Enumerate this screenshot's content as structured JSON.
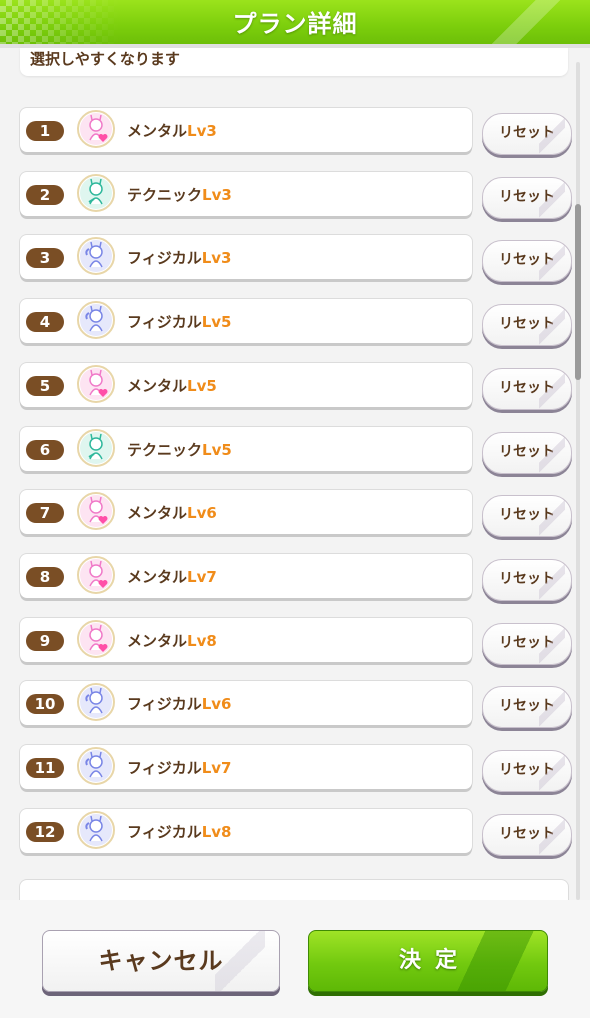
{
  "header": {
    "title": "プラン詳細"
  },
  "hint": {
    "text": "選択しやすくなります"
  },
  "rows": [
    {
      "num": "1",
      "name": "メンタル",
      "level": "Lv3",
      "icon": "mental-icon",
      "reset": "リセット"
    },
    {
      "num": "2",
      "name": "テクニック",
      "level": "Lv3",
      "icon": "technique-icon",
      "reset": "リセット"
    },
    {
      "num": "3",
      "name": "フィジカル",
      "level": "Lv3",
      "icon": "physical-icon",
      "reset": "リセット"
    },
    {
      "num": "4",
      "name": "フィジカル",
      "level": "Lv5",
      "icon": "physical-icon",
      "reset": "リセット"
    },
    {
      "num": "5",
      "name": "メンタル",
      "level": "Lv5",
      "icon": "mental-icon",
      "reset": "リセット"
    },
    {
      "num": "6",
      "name": "テクニック",
      "level": "Lv5",
      "icon": "technique-icon",
      "reset": "リセット"
    },
    {
      "num": "7",
      "name": "メンタル",
      "level": "Lv6",
      "icon": "mental-icon",
      "reset": "リセット"
    },
    {
      "num": "8",
      "name": "メンタル",
      "level": "Lv7",
      "icon": "mental-icon",
      "reset": "リセット"
    },
    {
      "num": "9",
      "name": "メンタル",
      "level": "Lv8",
      "icon": "mental-icon",
      "reset": "リセット"
    },
    {
      "num": "10",
      "name": "フィジカル",
      "level": "Lv6",
      "icon": "physical-icon",
      "reset": "リセット"
    },
    {
      "num": "11",
      "name": "フィジカル",
      "level": "Lv7",
      "icon": "physical-icon",
      "reset": "リセット"
    },
    {
      "num": "12",
      "name": "フィジカル",
      "level": "Lv8",
      "icon": "physical-icon",
      "reset": "リセット"
    }
  ],
  "footer": {
    "cancel_label": "キャンセル",
    "confirm_label": "決定"
  },
  "colors": {
    "accent_green": "#7cce0c",
    "text_brown": "#5a3a1e",
    "level_orange": "#f08c1a",
    "number_badge": "#7a4e25",
    "mental": "#f07ac8",
    "technique": "#2fb89c",
    "physical": "#7a86e6"
  }
}
